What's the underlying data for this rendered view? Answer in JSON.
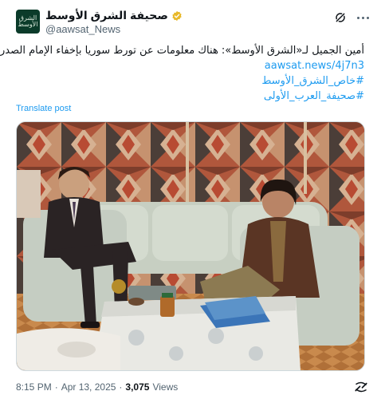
{
  "account": {
    "display_name": "صحيفة الشرق الأوسط",
    "handle": "@aawsat_News",
    "avatar_text": "الشرق الأوسط",
    "verified_color": "#e8b829"
  },
  "tweet": {
    "lines": [
      "أمين الجميل لـ«الشرق الأوسط»: هناك معلومات عن تورط سوريا بإخفاء الإمام الصدر"
    ],
    "link": "aawsat.news/4j7n3",
    "hashtags": [
      "#خاص_الشرق_الأوسط",
      "#صحيفة_العرب_الأولى"
    ],
    "translate_label": "Translate post"
  },
  "meta": {
    "time": "8:15 PM",
    "separator": "·",
    "date": "Apr 13, 2025",
    "views_count": "3,075",
    "views_label": "Views"
  },
  "colors": {
    "link": "#1d9bf0",
    "text": "#0f1419",
    "muted": "#536471"
  }
}
